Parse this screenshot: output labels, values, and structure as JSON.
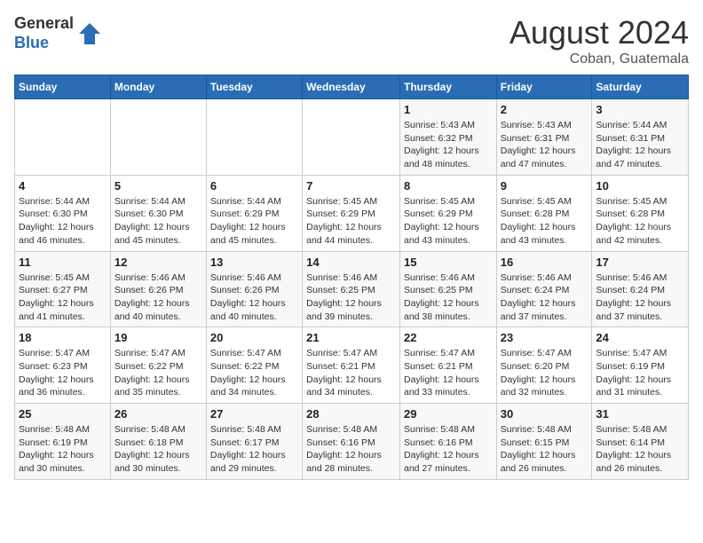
{
  "logo": {
    "general": "General",
    "blue": "Blue"
  },
  "title": "August 2024",
  "location": "Coban, Guatemala",
  "days_of_week": [
    "Sunday",
    "Monday",
    "Tuesday",
    "Wednesday",
    "Thursday",
    "Friday",
    "Saturday"
  ],
  "weeks": [
    [
      {
        "day": "",
        "sunrise": "",
        "sunset": "",
        "daylight": ""
      },
      {
        "day": "",
        "sunrise": "",
        "sunset": "",
        "daylight": ""
      },
      {
        "day": "",
        "sunrise": "",
        "sunset": "",
        "daylight": ""
      },
      {
        "day": "",
        "sunrise": "",
        "sunset": "",
        "daylight": ""
      },
      {
        "day": "1",
        "sunrise": "Sunrise: 5:43 AM",
        "sunset": "Sunset: 6:32 PM",
        "daylight": "Daylight: 12 hours and 48 minutes."
      },
      {
        "day": "2",
        "sunrise": "Sunrise: 5:43 AM",
        "sunset": "Sunset: 6:31 PM",
        "daylight": "Daylight: 12 hours and 47 minutes."
      },
      {
        "day": "3",
        "sunrise": "Sunrise: 5:44 AM",
        "sunset": "Sunset: 6:31 PM",
        "daylight": "Daylight: 12 hours and 47 minutes."
      }
    ],
    [
      {
        "day": "4",
        "sunrise": "Sunrise: 5:44 AM",
        "sunset": "Sunset: 6:30 PM",
        "daylight": "Daylight: 12 hours and 46 minutes."
      },
      {
        "day": "5",
        "sunrise": "Sunrise: 5:44 AM",
        "sunset": "Sunset: 6:30 PM",
        "daylight": "Daylight: 12 hours and 45 minutes."
      },
      {
        "day": "6",
        "sunrise": "Sunrise: 5:44 AM",
        "sunset": "Sunset: 6:29 PM",
        "daylight": "Daylight: 12 hours and 45 minutes."
      },
      {
        "day": "7",
        "sunrise": "Sunrise: 5:45 AM",
        "sunset": "Sunset: 6:29 PM",
        "daylight": "Daylight: 12 hours and 44 minutes."
      },
      {
        "day": "8",
        "sunrise": "Sunrise: 5:45 AM",
        "sunset": "Sunset: 6:29 PM",
        "daylight": "Daylight: 12 hours and 43 minutes."
      },
      {
        "day": "9",
        "sunrise": "Sunrise: 5:45 AM",
        "sunset": "Sunset: 6:28 PM",
        "daylight": "Daylight: 12 hours and 43 minutes."
      },
      {
        "day": "10",
        "sunrise": "Sunrise: 5:45 AM",
        "sunset": "Sunset: 6:28 PM",
        "daylight": "Daylight: 12 hours and 42 minutes."
      }
    ],
    [
      {
        "day": "11",
        "sunrise": "Sunrise: 5:45 AM",
        "sunset": "Sunset: 6:27 PM",
        "daylight": "Daylight: 12 hours and 41 minutes."
      },
      {
        "day": "12",
        "sunrise": "Sunrise: 5:46 AM",
        "sunset": "Sunset: 6:26 PM",
        "daylight": "Daylight: 12 hours and 40 minutes."
      },
      {
        "day": "13",
        "sunrise": "Sunrise: 5:46 AM",
        "sunset": "Sunset: 6:26 PM",
        "daylight": "Daylight: 12 hours and 40 minutes."
      },
      {
        "day": "14",
        "sunrise": "Sunrise: 5:46 AM",
        "sunset": "Sunset: 6:25 PM",
        "daylight": "Daylight: 12 hours and 39 minutes."
      },
      {
        "day": "15",
        "sunrise": "Sunrise: 5:46 AM",
        "sunset": "Sunset: 6:25 PM",
        "daylight": "Daylight: 12 hours and 38 minutes."
      },
      {
        "day": "16",
        "sunrise": "Sunrise: 5:46 AM",
        "sunset": "Sunset: 6:24 PM",
        "daylight": "Daylight: 12 hours and 37 minutes."
      },
      {
        "day": "17",
        "sunrise": "Sunrise: 5:46 AM",
        "sunset": "Sunset: 6:24 PM",
        "daylight": "Daylight: 12 hours and 37 minutes."
      }
    ],
    [
      {
        "day": "18",
        "sunrise": "Sunrise: 5:47 AM",
        "sunset": "Sunset: 6:23 PM",
        "daylight": "Daylight: 12 hours and 36 minutes."
      },
      {
        "day": "19",
        "sunrise": "Sunrise: 5:47 AM",
        "sunset": "Sunset: 6:22 PM",
        "daylight": "Daylight: 12 hours and 35 minutes."
      },
      {
        "day": "20",
        "sunrise": "Sunrise: 5:47 AM",
        "sunset": "Sunset: 6:22 PM",
        "daylight": "Daylight: 12 hours and 34 minutes."
      },
      {
        "day": "21",
        "sunrise": "Sunrise: 5:47 AM",
        "sunset": "Sunset: 6:21 PM",
        "daylight": "Daylight: 12 hours and 34 minutes."
      },
      {
        "day": "22",
        "sunrise": "Sunrise: 5:47 AM",
        "sunset": "Sunset: 6:21 PM",
        "daylight": "Daylight: 12 hours and 33 minutes."
      },
      {
        "day": "23",
        "sunrise": "Sunrise: 5:47 AM",
        "sunset": "Sunset: 6:20 PM",
        "daylight": "Daylight: 12 hours and 32 minutes."
      },
      {
        "day": "24",
        "sunrise": "Sunrise: 5:47 AM",
        "sunset": "Sunset: 6:19 PM",
        "daylight": "Daylight: 12 hours and 31 minutes."
      }
    ],
    [
      {
        "day": "25",
        "sunrise": "Sunrise: 5:48 AM",
        "sunset": "Sunset: 6:19 PM",
        "daylight": "Daylight: 12 hours and 30 minutes."
      },
      {
        "day": "26",
        "sunrise": "Sunrise: 5:48 AM",
        "sunset": "Sunset: 6:18 PM",
        "daylight": "Daylight: 12 hours and 30 minutes."
      },
      {
        "day": "27",
        "sunrise": "Sunrise: 5:48 AM",
        "sunset": "Sunset: 6:17 PM",
        "daylight": "Daylight: 12 hours and 29 minutes."
      },
      {
        "day": "28",
        "sunrise": "Sunrise: 5:48 AM",
        "sunset": "Sunset: 6:16 PM",
        "daylight": "Daylight: 12 hours and 28 minutes."
      },
      {
        "day": "29",
        "sunrise": "Sunrise: 5:48 AM",
        "sunset": "Sunset: 6:16 PM",
        "daylight": "Daylight: 12 hours and 27 minutes."
      },
      {
        "day": "30",
        "sunrise": "Sunrise: 5:48 AM",
        "sunset": "Sunset: 6:15 PM",
        "daylight": "Daylight: 12 hours and 26 minutes."
      },
      {
        "day": "31",
        "sunrise": "Sunrise: 5:48 AM",
        "sunset": "Sunset: 6:14 PM",
        "daylight": "Daylight: 12 hours and 26 minutes."
      }
    ]
  ]
}
